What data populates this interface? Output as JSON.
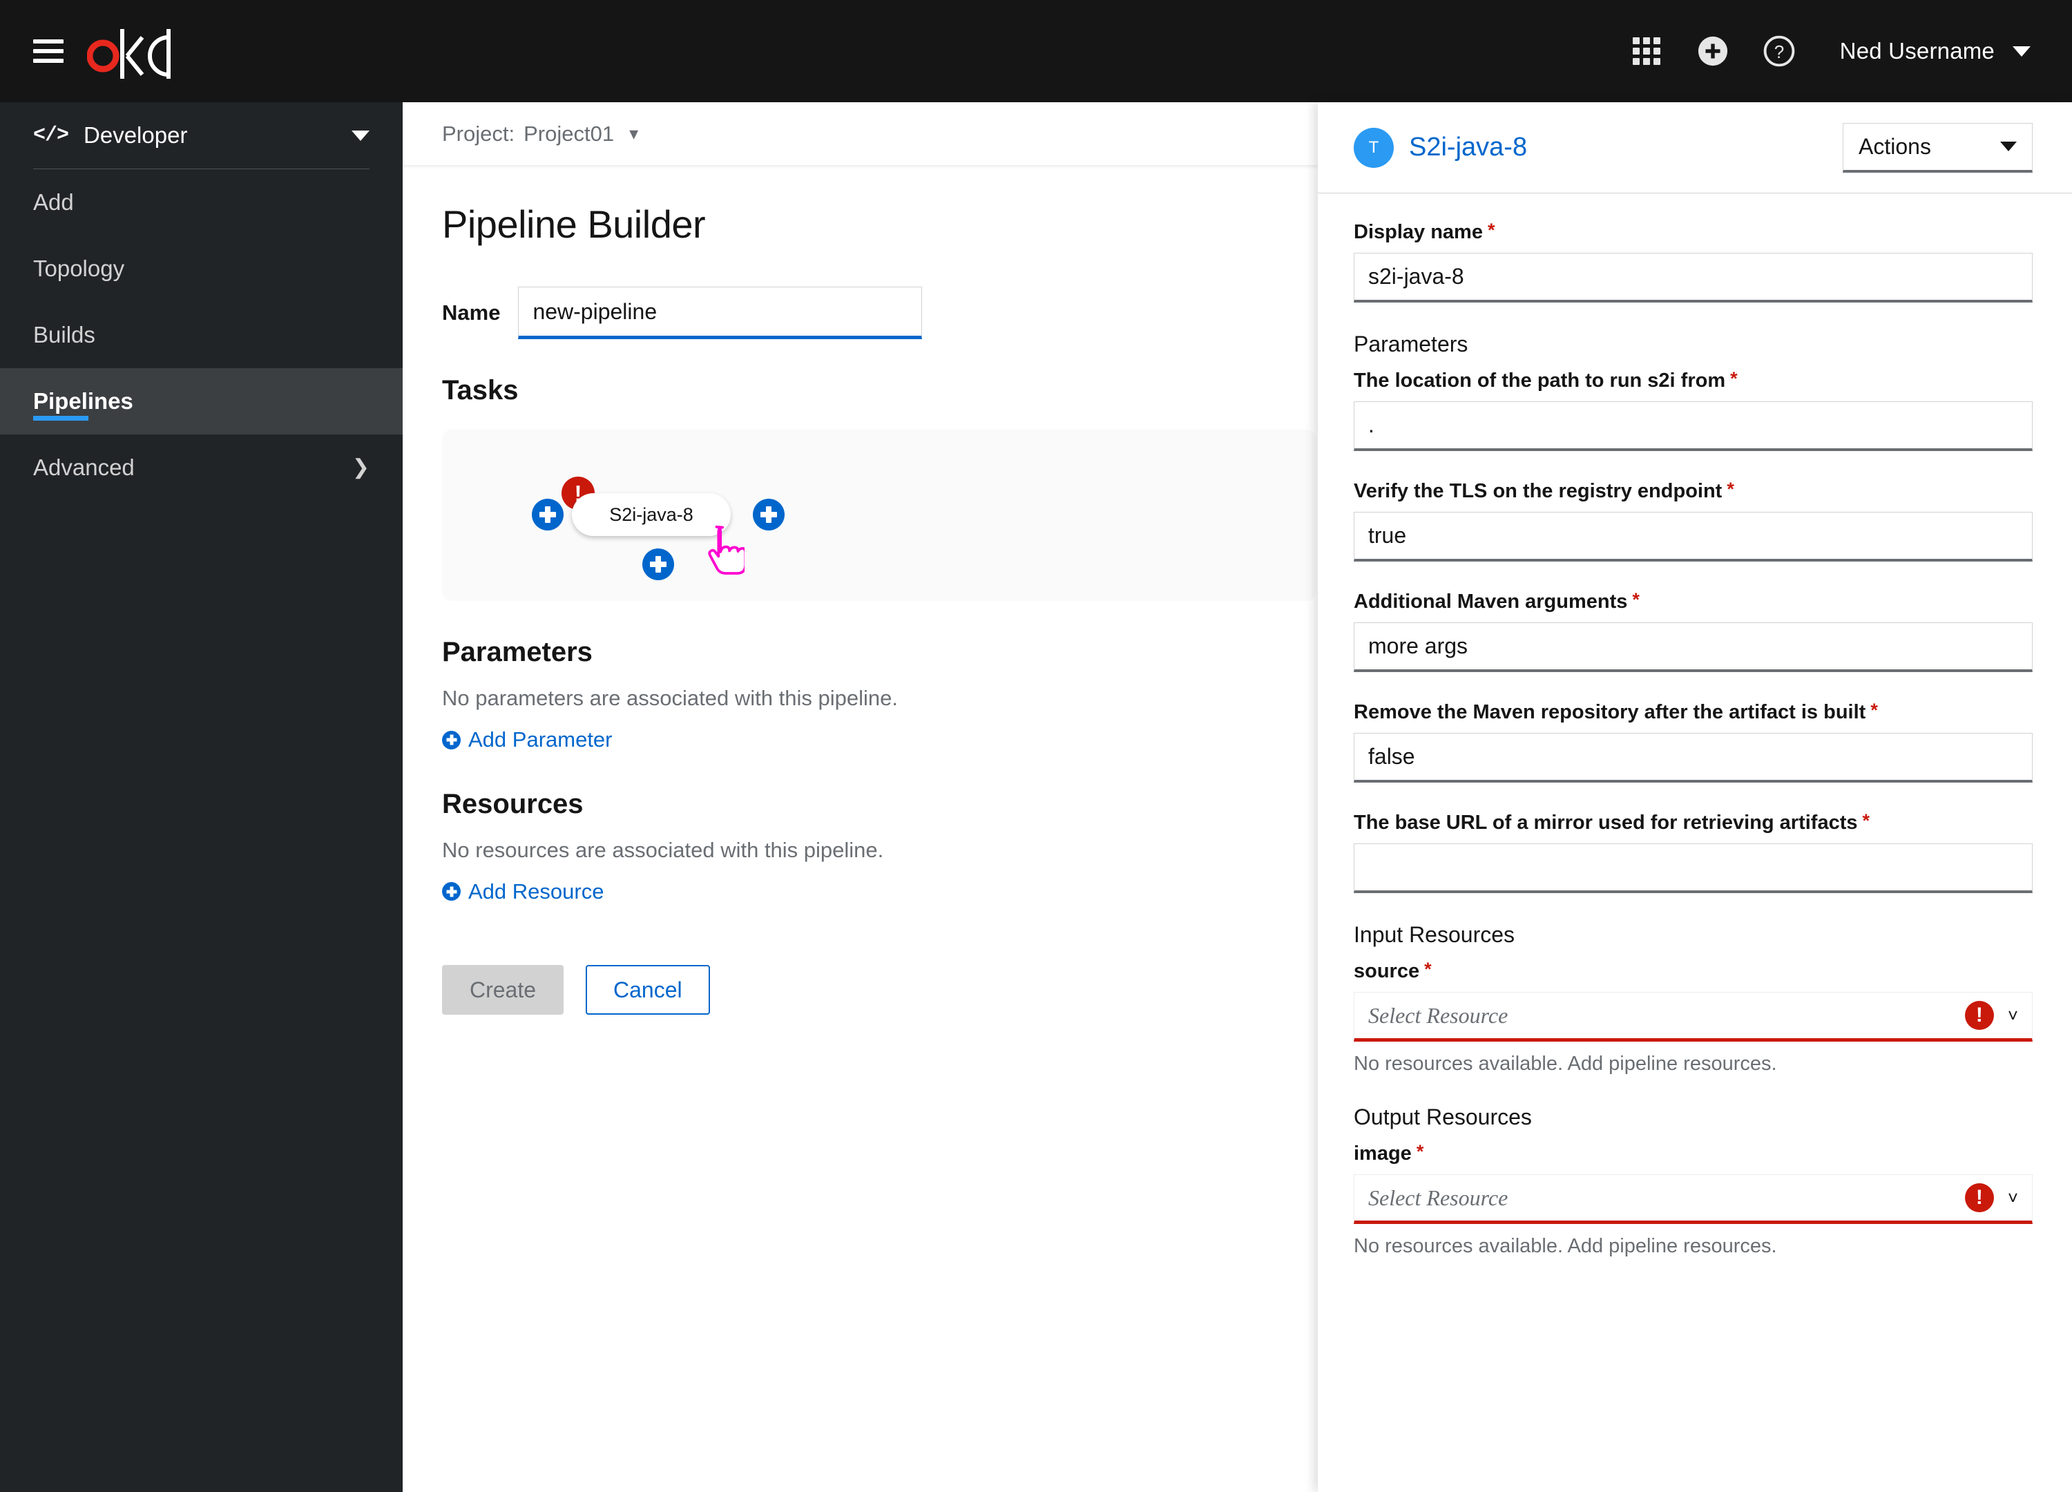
{
  "masthead": {
    "menu_icon": "hamburger-icon",
    "logo_text": "okd",
    "apps_icon": "grid-apps-icon",
    "add_icon": "plus-circle-icon",
    "help_icon": "question-circle-icon",
    "username": "Ned Username",
    "user_caret_icon": "caret-down-icon"
  },
  "sidebar": {
    "perspective": {
      "label": "Developer",
      "icon": "code-icon",
      "caret_icon": "caret-down-icon"
    },
    "items": [
      {
        "label": "Add",
        "active": false
      },
      {
        "label": "Topology",
        "active": false
      },
      {
        "label": "Builds",
        "active": false
      },
      {
        "label": "Pipelines",
        "active": true
      },
      {
        "label": "Advanced",
        "active": false,
        "chevron_icon": "chevron-right-icon"
      }
    ]
  },
  "breadcrumb": {
    "project_label": "Project:",
    "project_name": "Project01",
    "caret_icon": "caret-down-icon"
  },
  "main": {
    "page_title": "Pipeline Builder",
    "name_label": "Name",
    "name_value": "new-pipeline",
    "tasks_heading": "Tasks",
    "task_node_label": "S2i-java-8",
    "task_error_icon": "exclamation-circle-icon",
    "add_task_left_icon": "plus-circle-icon",
    "add_task_right_icon": "plus-circle-icon",
    "add_task_below_icon": "plus-circle-icon",
    "cursor_icon": "pointer-hand-cursor",
    "parameters_heading": "Parameters",
    "parameters_empty": "No parameters are associated with this pipeline.",
    "add_parameter_label": "Add Parameter",
    "resources_heading": "Resources",
    "resources_empty": "No resources are associated with this pipeline.",
    "add_resource_label": "Add Resource",
    "create_label": "Create",
    "cancel_label": "Cancel"
  },
  "sidepanel": {
    "badge_letter": "T",
    "title": "S2i-java-8",
    "actions_label": "Actions",
    "actions_caret_icon": "caret-down-icon",
    "display_name_label": "Display name",
    "display_name_value": "s2i-java-8",
    "parameters_heading": "Parameters",
    "required_marker": "*",
    "params": [
      {
        "label": "The location of the path to run s2i from",
        "value": ".",
        "required": true
      },
      {
        "label": "Verify the TLS on the registry endpoint",
        "value": "true",
        "required": true
      },
      {
        "label": "Additional Maven arguments",
        "value": "more args",
        "required": true
      },
      {
        "label": "Remove the Maven repository after the artifact is built",
        "value": "false",
        "required": true
      },
      {
        "label": "The base URL of a mirror used for retrieving artifacts",
        "value": "",
        "required": true
      }
    ],
    "input_resources_heading": "Input Resources",
    "input_resource": {
      "name": "source",
      "placeholder": "Select Resource",
      "error_icon": "exclamation-circle-icon",
      "chevron_icon": "chevron-down-icon",
      "hint": "No resources available.  Add pipeline resources."
    },
    "output_resources_heading": "Output Resources",
    "output_resource": {
      "name": "image",
      "placeholder": "Select Resource",
      "error_icon": "exclamation-circle-icon",
      "chevron_icon": "chevron-down-icon",
      "hint": "No resources available.  Add pipeline resources."
    }
  },
  "colors": {
    "masthead_bg": "#151515",
    "nav_bg": "#212427",
    "nav_active_bg": "#3c3f42",
    "accent_blue": "#06c",
    "active_underline": "#2b9af3",
    "logo_red": "#e8281e",
    "danger_red": "#c9190b",
    "cursor_magenta": "#ff00d0"
  }
}
